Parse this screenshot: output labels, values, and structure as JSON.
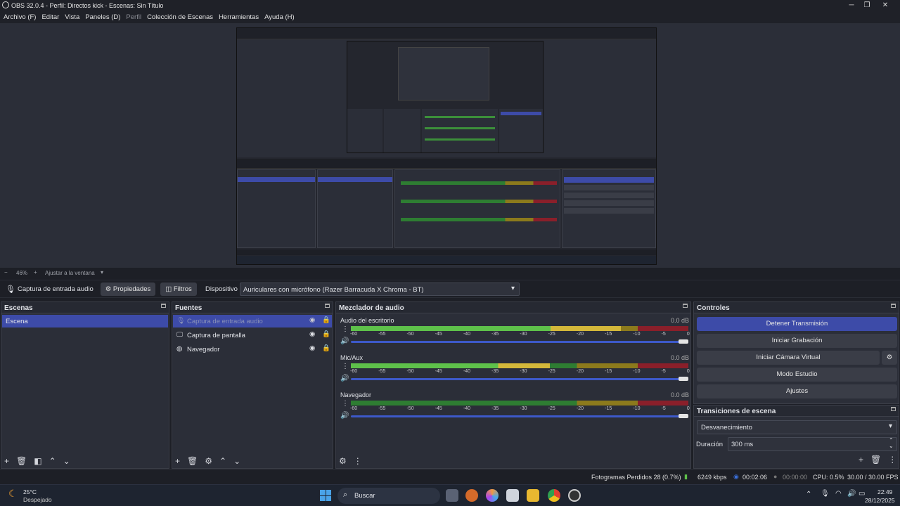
{
  "window": {
    "title": "OBS 32.0.4 - Perfil: Directos kick - Escenas: Sin Título"
  },
  "menu": [
    "Archivo (F)",
    "Editar",
    "Vista",
    "Paneles (D)",
    "Perfil",
    "Colección de Escenas",
    "Herramientas",
    "Ayuda (H)"
  ],
  "zoom": {
    "minus": "−",
    "value": "46%",
    "plus": "+",
    "fit": "Ajustar a la ventana"
  },
  "sourcebar": {
    "source_name": "Captura de entrada audio",
    "properties": "Propiedades",
    "filters": "Filtros",
    "device_label": "Dispositivo",
    "device_value": "Auriculares con micrófono (Razer Barracuda X Chroma - BT)"
  },
  "scenes": {
    "title": "Escenas",
    "items": [
      "Escena"
    ]
  },
  "sources": {
    "title": "Fuentes",
    "items": [
      "Captura de entrada audio",
      "Captura de pantalla",
      "Navegador"
    ]
  },
  "mixer": {
    "title": "Mezclador de audio",
    "ticks": [
      "-60",
      "-55",
      "-50",
      "-45",
      "-40",
      "-35",
      "-30",
      "-25",
      "-20",
      "-15",
      "-10",
      "-5",
      "0"
    ],
    "channels": [
      {
        "name": "Audio del escritorio",
        "db": "0.0 dB",
        "level": 0.8
      },
      {
        "name": "Mic/Aux",
        "db": "0.0 dB",
        "level": 0.59
      },
      {
        "name": "Navegador",
        "db": "0.0 dB",
        "level": 0.0
      }
    ]
  },
  "controls": {
    "title": "Controles",
    "stop_stream": "Detener Transmisión",
    "start_record": "Iniciar Grabación",
    "start_vcam": "Iniciar Cámara Virtual",
    "studio_mode": "Modo Estudio",
    "settings": "Ajustes"
  },
  "transitions": {
    "title": "Transiciones de escena",
    "selected": "Desvanecimiento",
    "duration_label": "Duración",
    "duration_value": "300 ms"
  },
  "status": {
    "dropped": "Fotogramas Perdidos 28 (0.7%)",
    "bitrate": "6249 kbps",
    "stream_time": "00:02:06",
    "rec_time": "00:00:00",
    "cpu": "CPU: 0.5%",
    "fps": "30.00 / 30.00 FPS"
  },
  "taskbar": {
    "temp": "25°C",
    "weather": "Despejado",
    "search": "Buscar",
    "time": "22:49",
    "date": "28/12/2025"
  },
  "colors": {
    "accent": "#3d4ba8",
    "panel": "#2b2e38",
    "bg": "#1d1f26",
    "meter_green": "#5ec14a",
    "meter_yellow": "#d4b83a",
    "meter_red": "#8a1f2a"
  },
  "icons": [
    "obs-logo-icon",
    "minimize-icon",
    "maximize-icon",
    "close-icon",
    "microphone-icon",
    "gear-icon",
    "filter-icon",
    "eye-icon",
    "lock-icon",
    "monitor-icon",
    "globe-icon",
    "speaker-icon",
    "plus-icon",
    "trash-icon",
    "chevron-up-icon",
    "chevron-down-icon",
    "kebab-icon",
    "windows-start-icon",
    "search-icon",
    "wifi-icon",
    "battery-icon",
    "network-icon"
  ]
}
